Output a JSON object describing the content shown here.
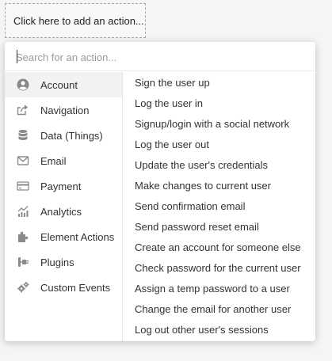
{
  "trigger": {
    "label": "Click here to add an action..."
  },
  "search": {
    "placeholder": "Search for an action...",
    "value": ""
  },
  "categories": [
    {
      "label": "Account",
      "icon": "user-circle-icon",
      "active": true
    },
    {
      "label": "Navigation",
      "icon": "share-arrow-icon",
      "active": false
    },
    {
      "label": "Data (Things)",
      "icon": "database-icon",
      "active": false
    },
    {
      "label": "Email",
      "icon": "envelope-icon",
      "active": false
    },
    {
      "label": "Payment",
      "icon": "credit-card-icon",
      "active": false
    },
    {
      "label": "Analytics",
      "icon": "line-chart-icon",
      "active": false
    },
    {
      "label": "Element Actions",
      "icon": "puzzle-icon",
      "active": false
    },
    {
      "label": "Plugins",
      "icon": "plug-icon",
      "active": false
    },
    {
      "label": "Custom Events",
      "icon": "gears-icon",
      "active": false
    }
  ],
  "actions": [
    "Sign the user up",
    "Log the user in",
    "Signup/login with a social network",
    "Log the user out",
    "Update the user's credentials",
    "Make changes to current user",
    "Send confirmation email",
    "Send password reset email",
    "Create an account for someone else",
    "Check password for the current user",
    "Assign a temp password to a user",
    "Change the email for another user",
    "Log out other user's sessions"
  ],
  "colors": {
    "icon": "#8a8a8a",
    "active_row": "#f2f2f2"
  }
}
